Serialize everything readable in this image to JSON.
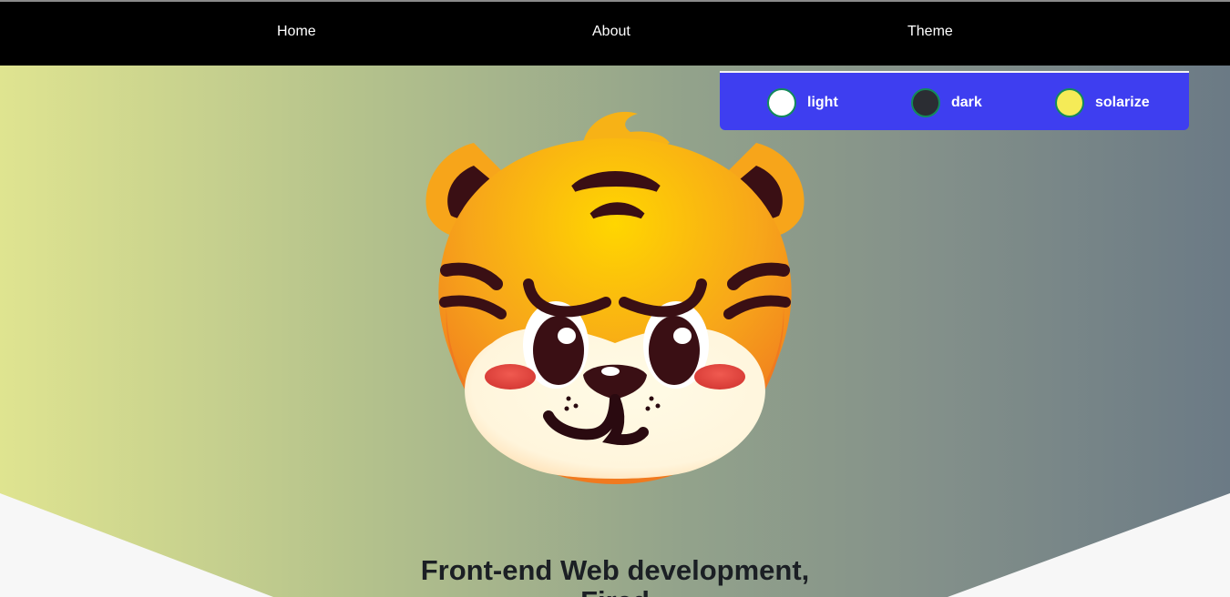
{
  "nav": {
    "home_label": "Home",
    "about_label": "About",
    "theme_label": "Theme"
  },
  "theme_menu": {
    "options": [
      {
        "label": "light",
        "color": "#ffffff"
      },
      {
        "label": "dark",
        "color": "#2b2d33"
      },
      {
        "label": "solarize",
        "color": "#f5eb57"
      }
    ],
    "background": "#3e3ef0"
  },
  "hero": {
    "title_line1": "Front-end Web development,",
    "title_line2": "Fired",
    "mascot_icon": "tiger-face-icon"
  },
  "colors": {
    "nav_bg": "#000000",
    "gradient_start": "#dfe490",
    "gradient_end": "#6b7a85",
    "accent": "#3e3ef0"
  }
}
